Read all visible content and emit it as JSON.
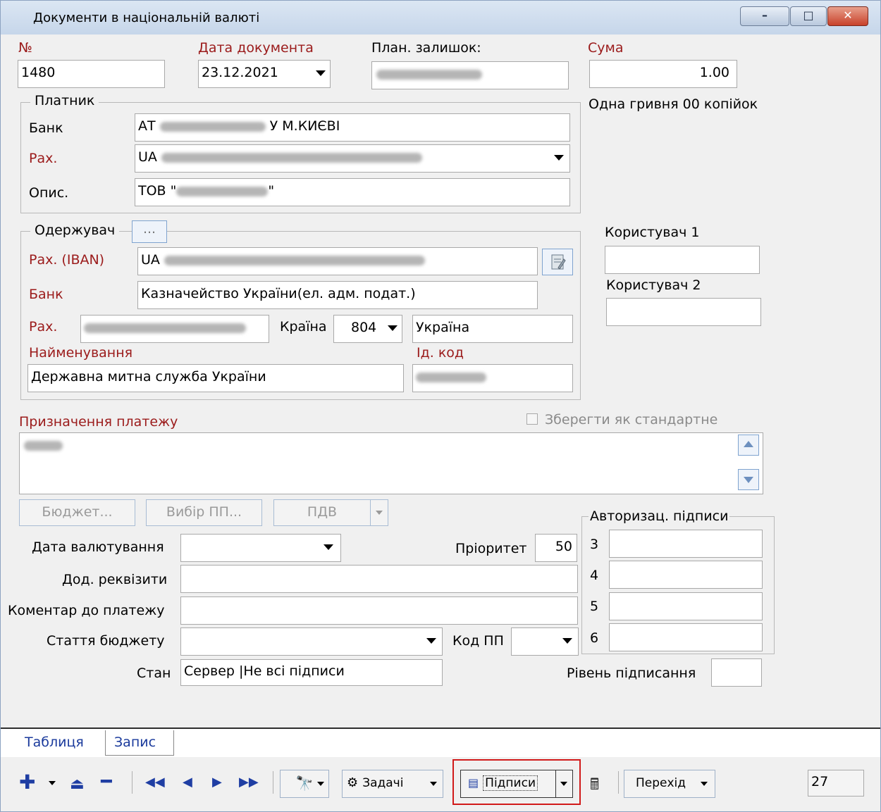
{
  "window": {
    "title": "Документи в національній валюті",
    "minimize": "–",
    "maximize": "□",
    "close": "✕"
  },
  "header": {
    "number_label": "№",
    "number_value": "1480",
    "date_label": "Дата документа",
    "date_value": "23.12.2021",
    "balance_label": "План. залишок:",
    "sum_label": "Сума",
    "sum_value": "1.00",
    "sum_words": "Одна гривня 00 копійок"
  },
  "payer": {
    "group_title": "Платник",
    "bank_label": "Банк",
    "bank_value_prefix": "АТ",
    "bank_value_suffix": "У М.КИЄВІ",
    "account_label": "Рах.",
    "account_value_prefix": "UA",
    "desc_label": "Опис.",
    "desc_value_prefix": "ТОВ \"",
    "desc_value_suffix": "\""
  },
  "recipient": {
    "group_title": "Одержувач",
    "browse_button": "...",
    "iban_label": "Рах. (IBAN)",
    "iban_value_prefix": "UA",
    "bank_label": "Банк",
    "bank_value": "Казначейство України(ел. адм. подат.)",
    "account_label": "Рах.",
    "country_label": "Країна",
    "country_code": "804",
    "country_name": "Україна",
    "name_label": "Найменування",
    "name_value": "Державна митна служба України",
    "id_label": "Ід. код"
  },
  "users": {
    "user1_label": "Користувач 1",
    "user2_label": "Користувач 2"
  },
  "purpose": {
    "label": "Призначення платежу",
    "save_default_label": "Зберегти як стандартне"
  },
  "buttons": {
    "budget": "Бюджет...",
    "choose_pp": "Вибір ПП...",
    "vat": "ПДВ"
  },
  "details": {
    "value_date_label": "Дата валютування",
    "priority_label": "Пріоритет",
    "priority_value": "50",
    "extra_label": "Дод. реквізити",
    "comment_label": "Коментар до платежу",
    "budget_article_label": "Стаття бюджету",
    "pp_code_label": "Код ПП",
    "state_label": "Стан",
    "state_value": "Сервер |Не всі підписи",
    "sign_level_label": "Рівень підписання"
  },
  "signatures": {
    "group_title": "Авторизац. підписи",
    "rows": [
      "3",
      "4",
      "5",
      "6"
    ]
  },
  "tabs": [
    "Таблиця",
    "Запис"
  ],
  "toolbar": {
    "tasks": "Задачі",
    "signatures": "Підписи",
    "goto": "Перехід",
    "counter": "27"
  }
}
